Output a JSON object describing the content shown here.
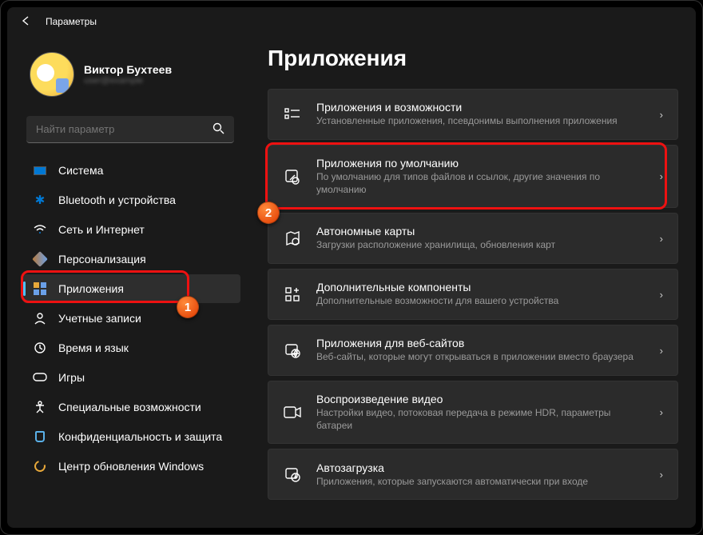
{
  "window": {
    "title": "Параметры"
  },
  "profile": {
    "name": "Виктор Бухтеев",
    "sub": "user@example"
  },
  "search": {
    "placeholder": "Найти параметр"
  },
  "sidebar": {
    "items": [
      {
        "label": "Система"
      },
      {
        "label": "Bluetooth и устройства"
      },
      {
        "label": "Сеть и Интернет"
      },
      {
        "label": "Персонализация"
      },
      {
        "label": "Приложения"
      },
      {
        "label": "Учетные записи"
      },
      {
        "label": "Время и язык"
      },
      {
        "label": "Игры"
      },
      {
        "label": "Специальные возможности"
      },
      {
        "label": "Конфиденциальность и защита"
      },
      {
        "label": "Центр обновления Windows"
      }
    ]
  },
  "main": {
    "heading": "Приложения",
    "cards": [
      {
        "title": "Приложения и возможности",
        "sub": "Установленные приложения, псевдонимы выполнения приложения"
      },
      {
        "title": "Приложения по умолчанию",
        "sub": "По умолчанию для типов файлов и ссылок, другие значения по умолчанию"
      },
      {
        "title": "Автономные карты",
        "sub": "Загрузки расположение хранилища, обновления карт"
      },
      {
        "title": "Дополнительные компоненты",
        "sub": "Дополнительные возможности для вашего устройства"
      },
      {
        "title": "Приложения для веб-сайтов",
        "sub": "Веб-сайты, которые могут открываться в приложении вместо браузера"
      },
      {
        "title": "Воспроизведение видео",
        "sub": "Настройки видео, потоковая передача в режиме HDR, параметры батареи"
      },
      {
        "title": "Автозагрузка",
        "sub": "Приложения, которые запускаются автоматически при входе"
      }
    ]
  },
  "annotations": {
    "one": "1",
    "two": "2"
  }
}
